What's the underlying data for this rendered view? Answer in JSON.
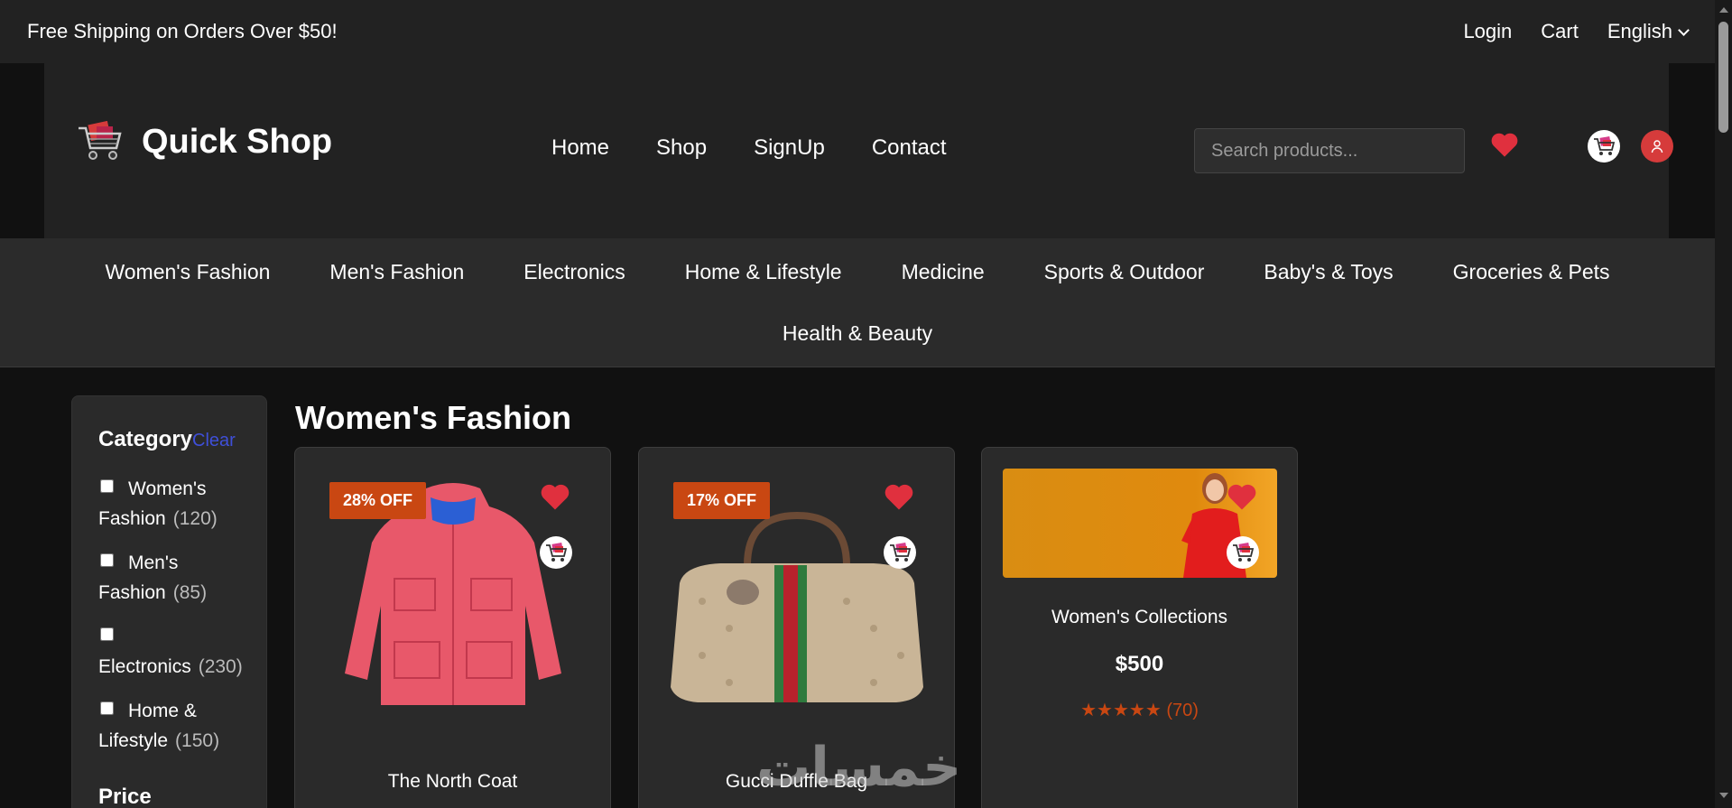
{
  "topbar": {
    "promo": "Free Shipping on Orders Over $50!",
    "login": "Login",
    "cart": "Cart",
    "language": "English"
  },
  "header": {
    "brand": "Quick Shop",
    "nav": [
      "Home",
      "Shop",
      "SignUp",
      "Contact"
    ],
    "search_placeholder": "Search products..."
  },
  "categories": [
    "Women's Fashion",
    "Men's Fashion",
    "Electronics",
    "Home & Lifestyle",
    "Medicine",
    "Sports & Outdoor",
    "Baby's & Toys",
    "Groceries & Pets",
    "Health & Beauty"
  ],
  "sidebar": {
    "title": "Category",
    "clear": "Clear",
    "items": [
      {
        "label": "Women's Fashion",
        "count": "(120)"
      },
      {
        "label": "Men's Fashion",
        "count": "(85)"
      },
      {
        "label": "Electronics",
        "count": "(230)"
      },
      {
        "label": "Home & Lifestyle",
        "count": "(150)"
      }
    ],
    "price_title": "Price"
  },
  "main": {
    "title": "Women's Fashion",
    "products": [
      {
        "badge": "28% OFF",
        "name": "The North Coat"
      },
      {
        "badge": "17% OFF",
        "name": "Gucci Duffle Bag"
      },
      {
        "name": "Women's Collections",
        "price": "$500",
        "stars": "★★★★★",
        "reviews": "(70)"
      }
    ]
  },
  "watermark": "خمسات",
  "colors": {
    "accent_red": "#e0303e",
    "badge": "#c94712",
    "clear_link": "#3f4fd8",
    "rating": "#c94712"
  },
  "icons": [
    "heart-icon",
    "cart-icon",
    "user-icon",
    "chevron-down-icon",
    "shopping-cart-logo-icon"
  ]
}
